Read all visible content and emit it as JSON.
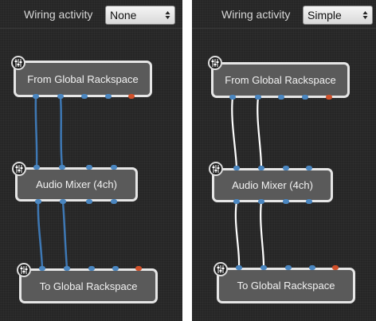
{
  "left_panel": {
    "wiring_label": "Wiring activity",
    "wiring_value": "None",
    "nodes": {
      "from": "From Global Rackspace",
      "mixer": "Audio Mixer (4ch)",
      "to": "To Global Rackspace"
    }
  },
  "right_panel": {
    "wiring_label": "Wiring activity",
    "wiring_value": "Simple",
    "nodes": {
      "from": "From Global Rackspace",
      "mixer": "Audio Mixer (4ch)",
      "to": "To Global Rackspace"
    }
  },
  "colors": {
    "audio_pin": "#4a86c0",
    "midi_pin": "#d0502a",
    "wire_none": "#3e78b4",
    "wire_simple": "#ffffff"
  },
  "icons": [
    "sliders-icon",
    "chevron-up-down-icon"
  ]
}
